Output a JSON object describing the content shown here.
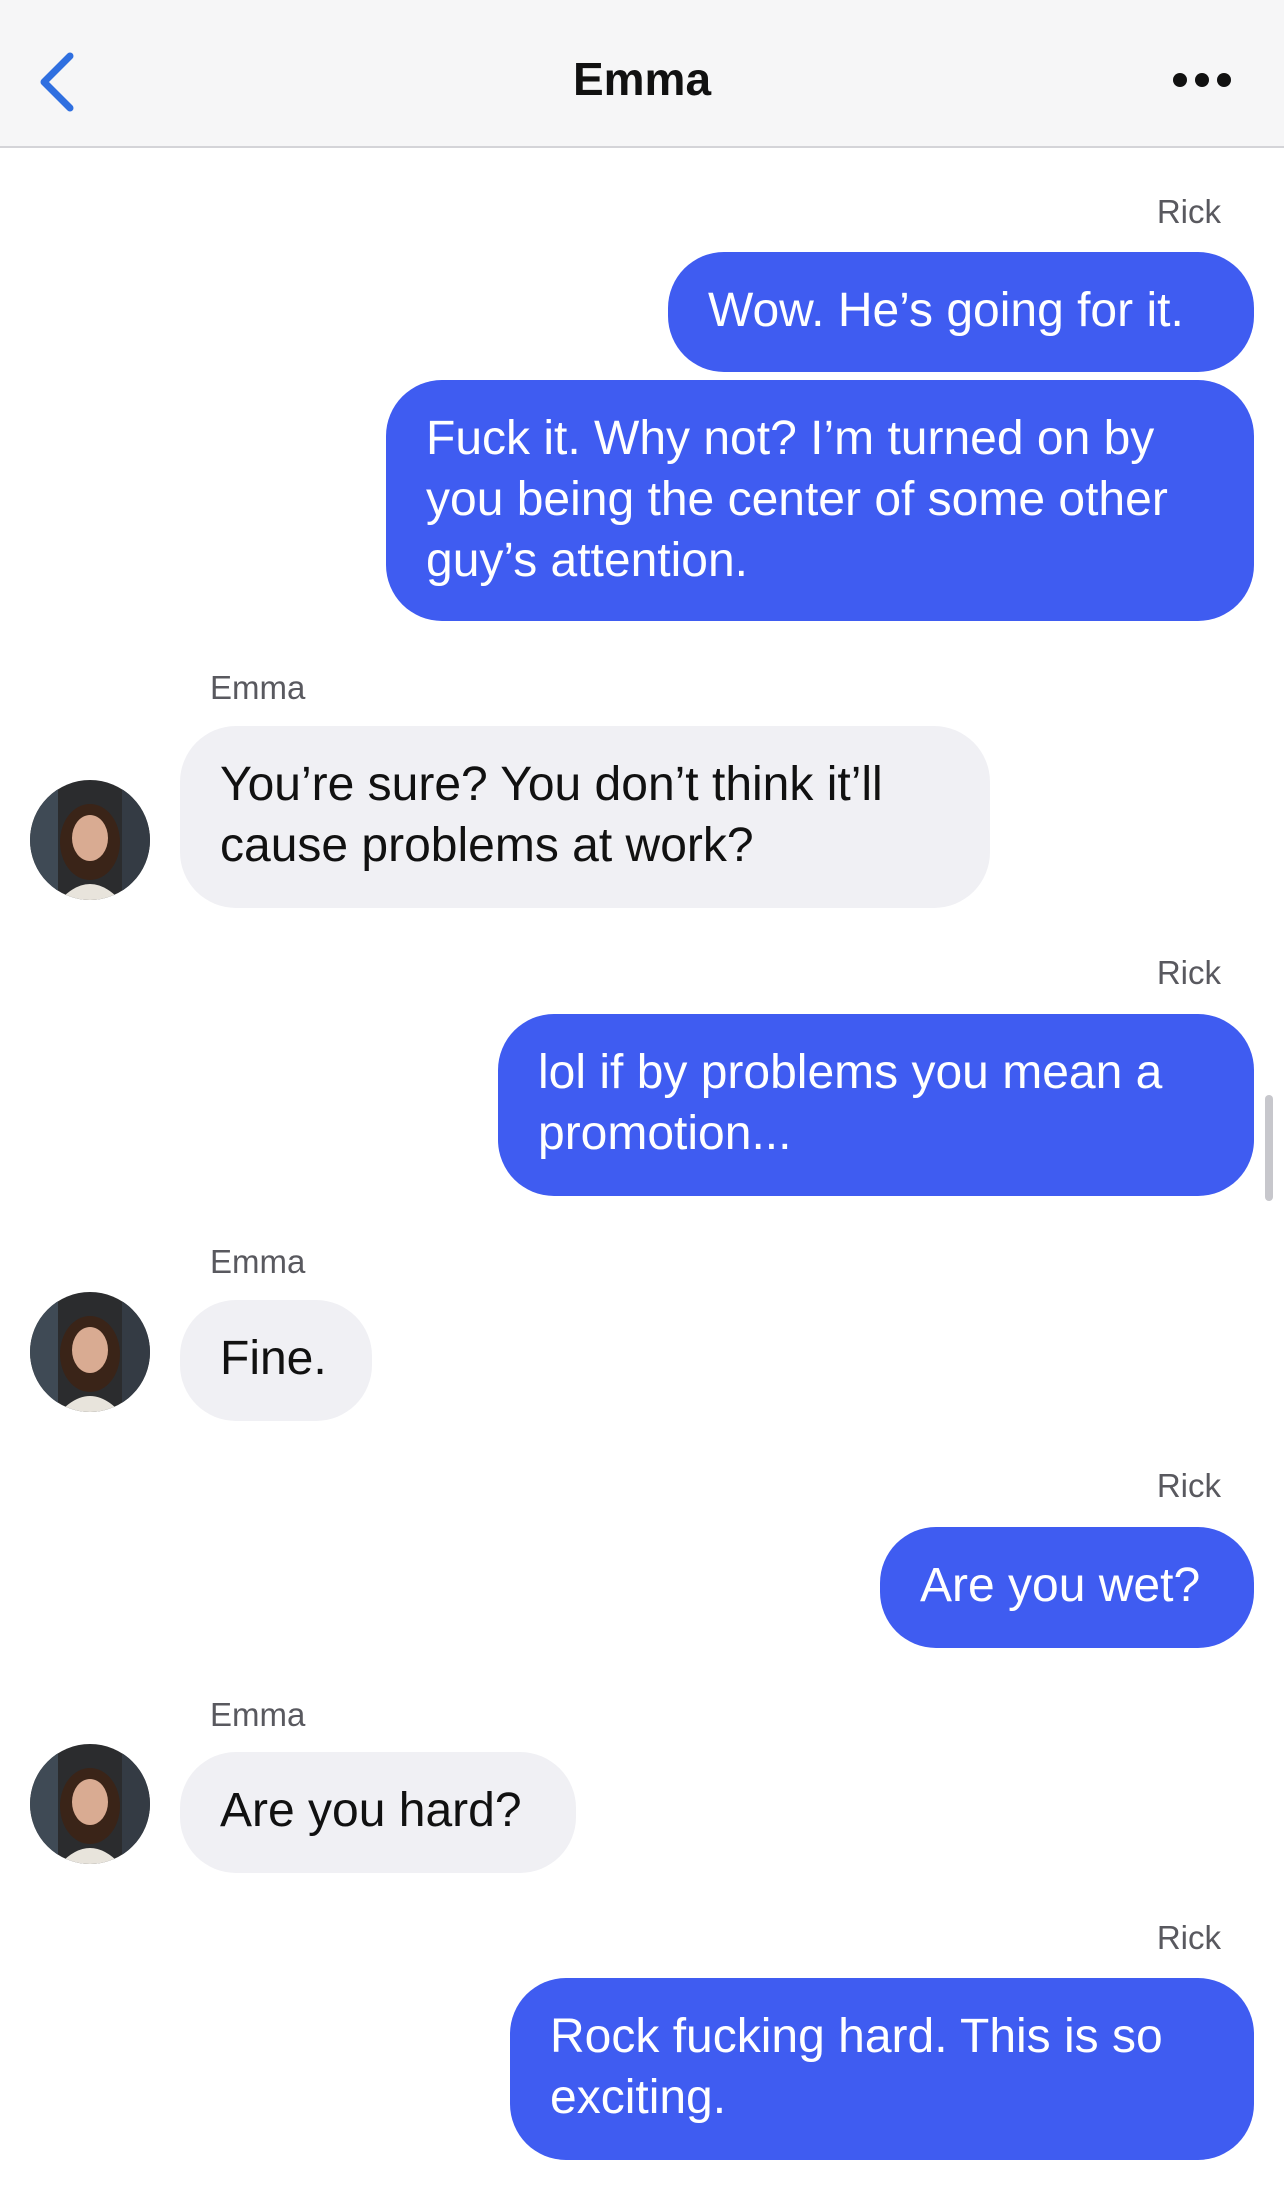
{
  "header": {
    "title": "Emma",
    "back_icon": "chevron-left-icon",
    "more_icon": "ellipsis-icon"
  },
  "messages": [
    {
      "sender": "Rick",
      "direction": "out",
      "text": "Wow. He’s going for it."
    },
    {
      "sender": "",
      "direction": "out",
      "text": "Fuck it. Why not? I’m turned on by you being the center of some other guy’s attention."
    },
    {
      "sender": "Emma",
      "direction": "in",
      "text": "You’re sure? You don’t think it’ll cause problems at work?"
    },
    {
      "sender": "Rick",
      "direction": "out",
      "text": "lol if by problems you mean a promotion..."
    },
    {
      "sender": "Emma",
      "direction": "in",
      "text": "Fine."
    },
    {
      "sender": "Rick",
      "direction": "out",
      "text": "Are you wet?"
    },
    {
      "sender": "Emma",
      "direction": "in",
      "text": "Are you hard?"
    },
    {
      "sender": "Rick",
      "direction": "out",
      "text": "Rock fucking hard. This is so exciting."
    }
  ],
  "colors": {
    "outgoing_bubble": "#3f5cf1",
    "incoming_bubble": "#f0f0f4",
    "accent": "#2f6fe0"
  }
}
